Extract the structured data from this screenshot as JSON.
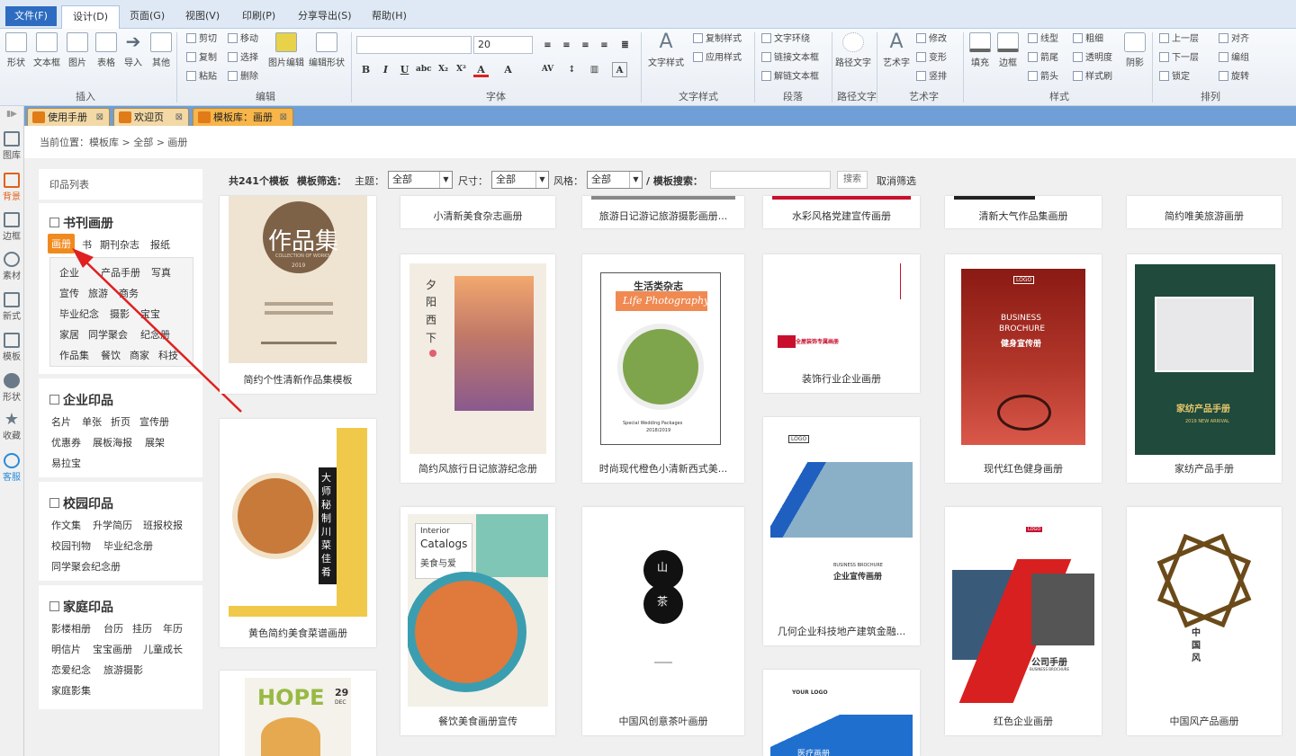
{
  "menu": [
    "文件(F)",
    "设计(D)",
    "页面(G)",
    "视图(V)",
    "印刷(P)",
    "分享导出(S)",
    "帮助(H)"
  ],
  "ribbon": {
    "insert": {
      "label": "插入",
      "buttons": [
        "形状",
        "文本框",
        "图片",
        "表格",
        "导入",
        "其他"
      ]
    },
    "edit": {
      "label": "编辑",
      "small": [
        "剪切",
        "移动",
        "复制",
        "选择",
        "粘贴",
        "删除"
      ],
      "big": [
        "图片编辑",
        "编辑形状"
      ]
    },
    "font": {
      "label": "字体",
      "size": "20"
    },
    "textstyle": {
      "label": "文字样式",
      "big": "文字样式",
      "small": [
        "复制样式",
        "应用样式"
      ]
    },
    "paragraph": {
      "label": "段落",
      "small": [
        "文字环绕",
        "链接文本框",
        "解链文本框"
      ]
    },
    "pathtext": {
      "label": "路径文字",
      "big": "路径文字"
    },
    "arttext": {
      "label": "艺术字",
      "big": "艺术字",
      "small": [
        "修改",
        "变形",
        "竖排"
      ]
    },
    "style": {
      "label": "样式",
      "big": [
        "填充",
        "边框"
      ],
      "small": [
        "线型",
        "粗细",
        "箭尾",
        "透明度",
        "箭头",
        "样式刷"
      ],
      "shadow": "阴影"
    },
    "arrange": {
      "label": "排列",
      "small": [
        "上一层",
        "对齐",
        "下一层",
        "编组",
        "锁定",
        "旋转"
      ]
    }
  },
  "tabs": [
    {
      "label": "使用手册",
      "close": "⊠"
    },
    {
      "label": "欢迎页",
      "close": "⊠"
    },
    {
      "label": "模板库：画册",
      "close": "⊠"
    }
  ],
  "leftstrip": [
    "图库",
    "背景",
    "边框",
    "素材",
    "新式",
    "模板",
    "形状",
    "收藏",
    "客服"
  ],
  "breadcrumb": "当前位置：模板库 > 全部 > 画册",
  "sidebar": {
    "head": "印品列表",
    "sections": [
      {
        "title": "书刊画册",
        "links": [
          "画册",
          "书",
          "期刊杂志",
          "报纸"
        ],
        "sub": [
          "企业",
          "产品手册",
          "写真",
          "宣传",
          "旅游",
          "商务",
          "毕业纪念",
          "摄影",
          "宝宝",
          "家居",
          "同学聚会",
          "纪念册",
          "作品集",
          "餐饮",
          "商家",
          "科技"
        ]
      },
      {
        "title": "企业印品",
        "links": [
          "名片",
          "单张",
          "折页",
          "宣传册",
          "优惠券",
          "展板海报",
          "展架",
          "易拉宝"
        ]
      },
      {
        "title": "校园印品",
        "links": [
          "作文集",
          "升学简历",
          "班报校报",
          "校园刊物",
          "毕业纪念册",
          "同学聚会纪念册"
        ]
      },
      {
        "title": "家庭印品",
        "links": [
          "影楼相册",
          "台历",
          "挂历",
          "年历",
          "明信片",
          "宝宝画册",
          "儿童成长",
          "恋爱纪念",
          "旅游摄影",
          "家庭影集"
        ]
      }
    ]
  },
  "filter": {
    "count": "共241个模板",
    "label": "模板筛选：",
    "theme_label": "主题：",
    "theme": "全部",
    "size_label": "尺寸：",
    "size": "全部",
    "style_label": "风格：",
    "style": "全部",
    "search_label": "/ 模板搜索：",
    "search_value": "",
    "search_btn": "搜索",
    "cancel": "取消筛选"
  },
  "cards": {
    "top": [
      "小清新美食杂志画册",
      "旅游日记游记旅游摄影画册...",
      "水彩风格党建宣传画册",
      "清新大气作品集画册",
      "简约唯美旅游画册"
    ],
    "c1": "简约个性清新作品集模板",
    "c2": "简约风旅行日记旅游纪念册",
    "c3": "时尚现代橙色小清新西式美...",
    "c4": "装饰行业企业画册",
    "c5": "现代红色健身画册",
    "c6": "家纺产品手册",
    "c7": "黄色简约美食菜谱画册",
    "c8": "餐饮美食画册宣传",
    "c9": "中国风创意茶叶画册",
    "c10": "几何企业科技地产建筑金融...",
    "c11": "红色企业画册",
    "c12": "中国风产品画册"
  },
  "thumbs": {
    "zpj": {
      "title": "作品集",
      "sub": "COLLECTION OF WORKS",
      "year": "2019"
    },
    "xy": {
      "v": [
        "夕",
        "阳",
        "西",
        "下"
      ]
    },
    "life": {
      "cn": "生活类杂志",
      "en": "Life Photography",
      "foot": "Special Wedding Packages",
      "year": "2018/2019"
    },
    "deco": {
      "t": "全屋装饰专属画册"
    },
    "biz": {
      "logo": "LOGO",
      "l1": "BUSINESS",
      "l2": "BROCHURE",
      "l3": "健身宣传册"
    },
    "home": {
      "t": "家纺产品手册",
      "s": "2019 NEW ARRIVAL"
    },
    "food": {
      "v": "大师秘制川菜佳肴"
    },
    "catalog": {
      "l1": "Interior",
      "l2": "Catalogs",
      "l3": "美食与爱"
    },
    "tea": {
      "a": "山",
      "b": "茶"
    },
    "geo": {
      "logo": "LOGO",
      "l1": "BUSINESS BROCHURE",
      "l2": "企业宣传画册"
    },
    "red": {
      "logo": "LOGO",
      "l1": "公司手册",
      "l2": "BUSINESS BROCHURE"
    },
    "cn": {
      "t": "中国风"
    },
    "hope": {
      "t": "HOPE",
      "d": "29",
      "m": "DEC"
    },
    "med": {
      "logo": "YOUR LOGO",
      "t": "医疗画册"
    }
  },
  "colors": {
    "accent": "#f08a1e",
    "menu": "#2d6cc0",
    "red": "#e02020"
  }
}
